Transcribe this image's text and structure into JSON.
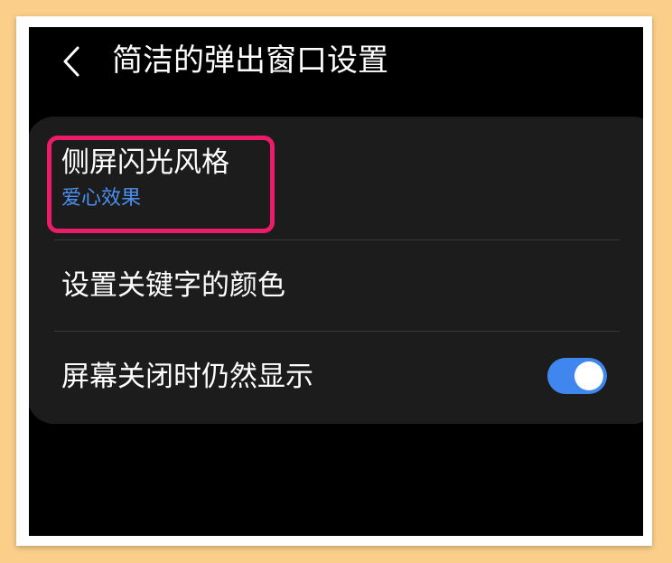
{
  "header": {
    "title": "简洁的弹出窗口设置",
    "back_icon": "chevron-left-icon"
  },
  "settings": {
    "edge_flash_style": {
      "label": "侧屏闪光风格",
      "value": "爱心效果"
    },
    "keyword_color": {
      "label": "设置关键字的颜色"
    },
    "show_when_screen_off": {
      "label": "屏幕关闭时仍然显示",
      "toggle_on": true
    }
  },
  "colors": {
    "accent": "#3f86ef",
    "highlight_border": "#ee1a6a",
    "subtitle": "#4c8ff0",
    "background": "#000000",
    "card": "#1c1c1c",
    "outer_border": "#fbcf8a"
  }
}
